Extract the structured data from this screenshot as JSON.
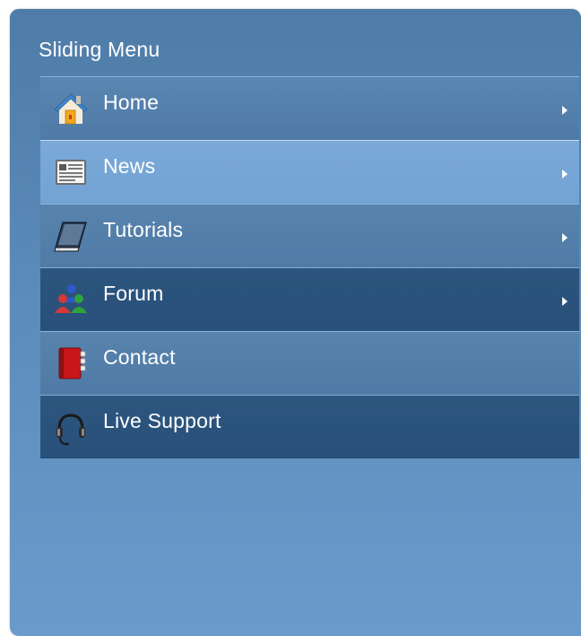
{
  "menu": {
    "title": "Sliding Menu",
    "colors": {
      "panel_top": "#4f7ca7",
      "panel_bottom": "#6a9bcc",
      "item_highlight": "#7aa9d8",
      "item_dark": "#28507a"
    },
    "items": [
      {
        "label": "Home",
        "icon": "home-icon",
        "has_submenu": true
      },
      {
        "label": "News",
        "icon": "newspaper-icon",
        "has_submenu": true
      },
      {
        "label": "Tutorials",
        "icon": "book-icon",
        "has_submenu": true
      },
      {
        "label": "Forum",
        "icon": "users-icon",
        "has_submenu": true
      },
      {
        "label": "Contact",
        "icon": "address-book-icon",
        "has_submenu": false
      },
      {
        "label": "Live Support",
        "icon": "headset-icon",
        "has_submenu": false
      }
    ]
  }
}
